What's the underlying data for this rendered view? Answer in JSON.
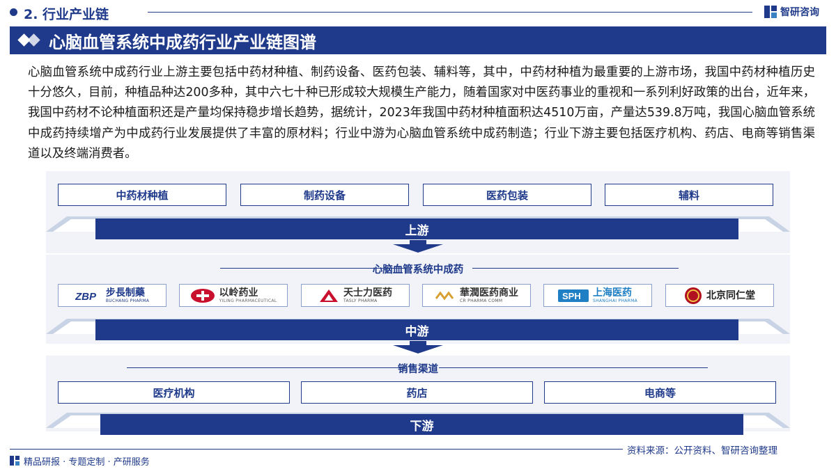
{
  "header": {
    "section_title": "2. 行业产业链",
    "brand": "智研咨询"
  },
  "title": "心脑血管系统中成药行业产业链图谱",
  "intro": "心脑血管系统中成药行业上游主要包括中药材种植、制药设备、医药包装、辅料等，其中，中药材种植为最重要的上游市场，我国中药材种植历史十分悠久，目前，种植品种达200多种，其中六七十种已形成较大规模生产能力，随着国家对中医药事业的重视和一系列利好政策的出台，近年来，我国中药材不论种植面积还是产量均保持稳步增长趋势，据统计，2023年我国中药材种植面积达4510万亩，产量达539.8万吨，我国心脑血管系统中成药持续增产为中成药行业发展提供了丰富的原材料；行业中游为心脑血管系统中成药制造；行业下游主要包括医疗机构、药店、电商等销售渠道以及终端消费者。",
  "upstream": {
    "items": [
      "中药材种植",
      "制药设备",
      "医药包装",
      "辅料"
    ],
    "label": "上游"
  },
  "midstream": {
    "title": "心脑血管系统中成药",
    "label": "中游",
    "companies": [
      {
        "mark": "ZBP",
        "name": "步長制藥",
        "sub": "BUCHANG PHARMA",
        "color": "#1f3a8a",
        "icon": "zbp-logo"
      },
      {
        "mark": "",
        "name": "以岭药业",
        "sub": "YILING PHARMACEUTICAL",
        "color": "#c8102e",
        "icon": "yiling-logo"
      },
      {
        "mark": "",
        "name": "天士力医药",
        "sub": "TASLY PHARMA",
        "color": "#c8102e",
        "icon": "tasly-logo"
      },
      {
        "mark": "",
        "name": "華潤医药商业",
        "sub": "CR PHARMA COMM",
        "color": "#d8a032",
        "icon": "cr-logo"
      },
      {
        "mark": "SPH",
        "name": "上海医药",
        "sub": "SHANGHAI PHARMA",
        "color": "#1f7fc4",
        "icon": "sph-logo"
      },
      {
        "mark": "",
        "name": "北京同仁堂",
        "sub": "",
        "color": "#b01020",
        "icon": "tongrentang-logo"
      }
    ]
  },
  "downstream": {
    "title": "销售渠道",
    "items": [
      "医疗机构",
      "药店",
      "电商等"
    ],
    "label": "下游"
  },
  "footer": {
    "source": "资料来源：公开资料、智研咨询整理",
    "tagline": "精品研报 · 专题定制 · 产研服务"
  }
}
